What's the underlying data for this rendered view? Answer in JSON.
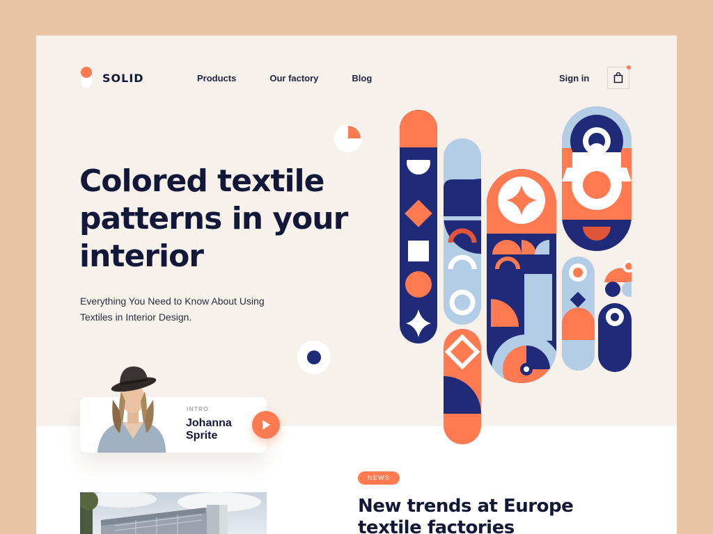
{
  "header": {
    "logo_text": "SOLID",
    "nav": [
      {
        "label": "Products"
      },
      {
        "label": "Our factory"
      },
      {
        "label": "Blog"
      }
    ],
    "signin_label": "Sign in",
    "cart_icon": "shopping-bag-icon"
  },
  "hero": {
    "title": "Colored textile patterns in your interior",
    "subtitle": "Everything You Need to Know About Using Textiles in Interior Design."
  },
  "intro": {
    "label": "INTRO",
    "name": "Johanna Sprite",
    "play_icon": "play-icon"
  },
  "news": {
    "badge": "NEWS",
    "title": "New trends at Europe textile factories"
  },
  "colors": {
    "orange": "#ff7a50",
    "navy": "#1f2a78",
    "light_blue": "#b4cde6",
    "dark_text": "#141838",
    "page_bg": "#f7f1ec",
    "outer_bg": "#e8c4a4"
  }
}
